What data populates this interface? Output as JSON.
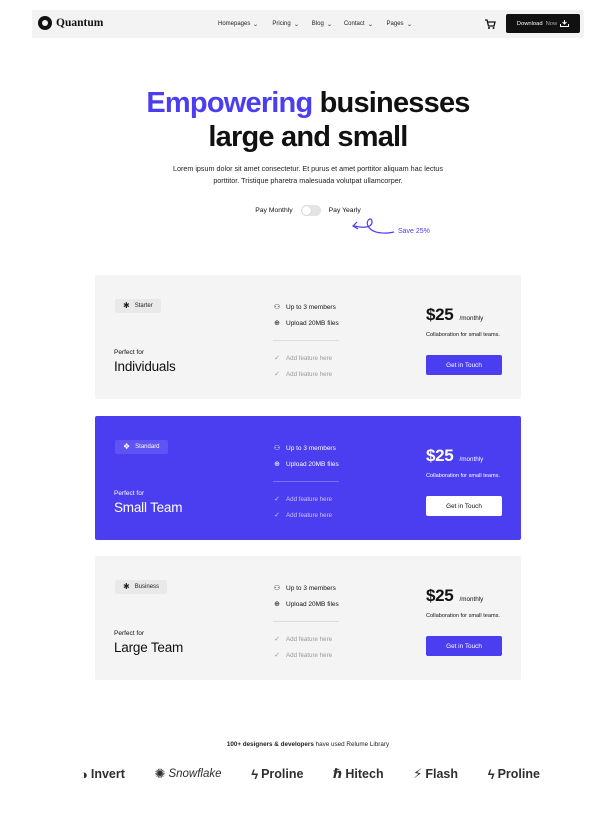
{
  "nav": {
    "brand": "Quantum",
    "links": [
      "Homepages",
      "Pricing",
      "Blog",
      "Contact",
      "Pages"
    ],
    "download_label": "Download",
    "download_suffix": "Now",
    "cart_icon": "cart-icon"
  },
  "hero": {
    "title_accent": "Empowering",
    "title_rest1": " businesses",
    "title_line2": "large and small",
    "subtitle": "Lorem ipsum dolor sit amet consectetur. Et purus et amet porttitor aliquam hac lectus porttitor. Tristique pharetra malesuada volutpat ullamcorper.",
    "toggle_monthly": "Pay Monthly",
    "toggle_yearly": "Pay Yearly",
    "save_text": "Save 25%"
  },
  "plans": [
    {
      "badge": "Starter",
      "badge_icon": "asterisk-icon",
      "perfect_for": "Perfect for",
      "name": "Individuals",
      "features": [
        "Up to 3 members",
        "Upload 20MB files"
      ],
      "muted_features": [
        "Add feature here",
        "Add feature here"
      ],
      "price": "$25",
      "period": "/monthly",
      "description": "Collaboration for small teams.",
      "cta": "Get in Touch"
    },
    {
      "badge": "Standard",
      "badge_icon": "diamond-icon",
      "perfect_for": "Perfect for",
      "name": "Small Team",
      "features": [
        "Up to 3 members",
        "Upload 20MB files"
      ],
      "muted_features": [
        "Add feature here",
        "Add feature here"
      ],
      "price": "$25",
      "period": "/monthly",
      "description": "Collaboration for small teams.",
      "cta": "Get in Touch"
    },
    {
      "badge": "Business",
      "badge_icon": "asterisk-icon",
      "perfect_for": "Perfect for",
      "name": "Large Team",
      "features": [
        "Up to 3 members",
        "Upload 20MB files"
      ],
      "muted_features": [
        "Add feature here",
        "Add feature here"
      ],
      "price": "$25",
      "period": "/monthly",
      "description": "Collaboration for small teams.",
      "cta": "Get in Touch"
    }
  ],
  "trusted": {
    "bold": "100+ designers & developers",
    "rest": " have used Relume Library"
  },
  "logos": [
    "Invert",
    "Snowflake",
    "Proline",
    "Hitech",
    "Flash",
    "Proline"
  ],
  "colors": {
    "accent": "#4b3df0",
    "card_bg": "#f4f4f4",
    "dark": "#111111"
  }
}
